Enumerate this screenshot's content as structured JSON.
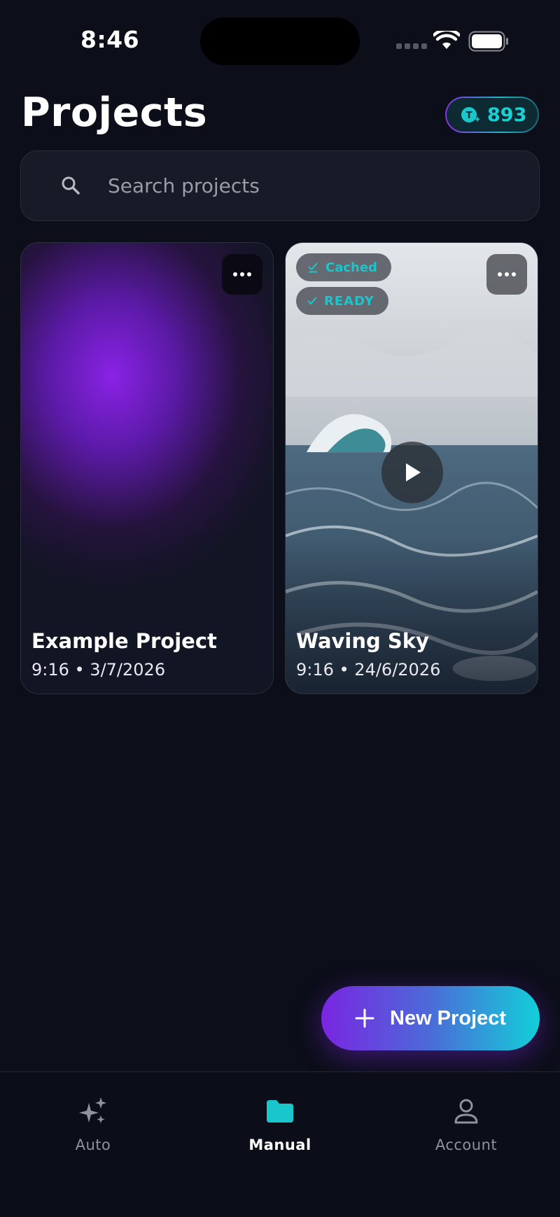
{
  "status_bar": {
    "time": "8:46"
  },
  "header": {
    "title": "Projects",
    "credits": "893"
  },
  "search": {
    "placeholder": "Search projects",
    "value": ""
  },
  "projects": [
    {
      "title": "Example Project",
      "meta": "9:16 • 3/7/2026"
    },
    {
      "title": "Waving Sky",
      "meta": "9:16 • 24/6/2026",
      "badges": [
        "Cached",
        "READY"
      ]
    }
  ],
  "fab": {
    "label": "New Project"
  },
  "tabs": [
    {
      "label": "Auto",
      "icon": "sparkles-icon"
    },
    {
      "label": "Manual",
      "icon": "folder-icon",
      "active": true
    },
    {
      "label": "Account",
      "icon": "user-icon"
    }
  ],
  "colors": {
    "background": "#0c0e19",
    "accent_cyan": "#19d0d4",
    "accent_purple": "#7a25e2"
  }
}
